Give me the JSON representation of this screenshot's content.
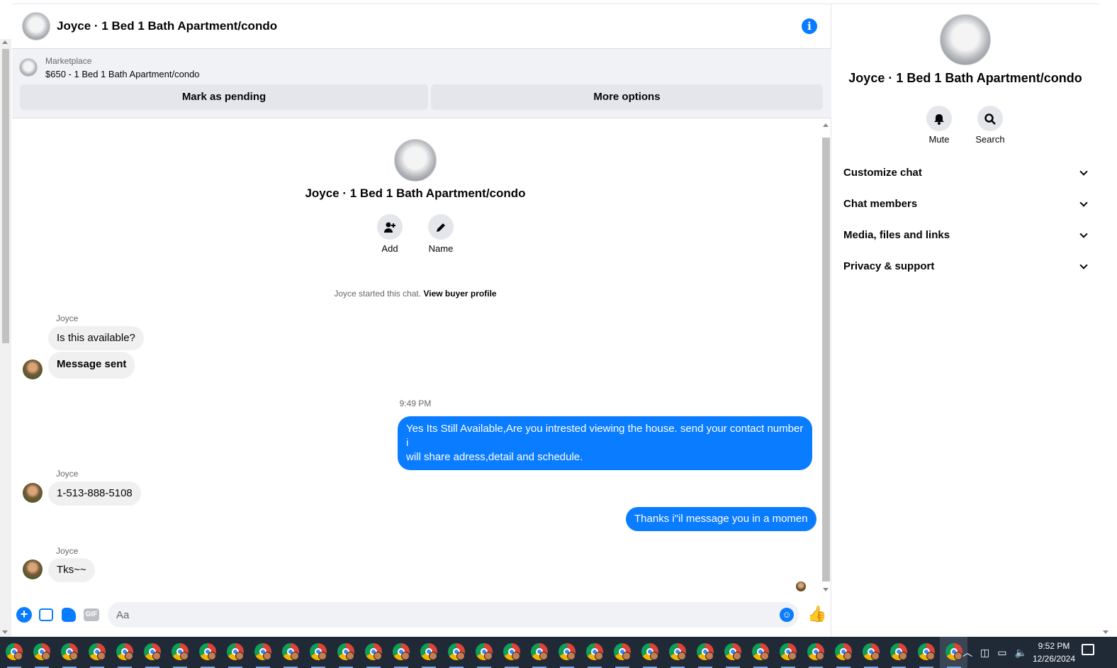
{
  "header": {
    "title": "Joyce · 1 Bed 1 Bath Apartment/condo",
    "info_icon": "info-icon"
  },
  "marketplace": {
    "label": "Marketplace",
    "listing": "$650 - 1 Bed 1 Bath Apartment/condo",
    "pending_button": "Mark as pending",
    "options_button": "More options"
  },
  "intro": {
    "title": "Joyce · 1 Bed 1 Bath Apartment/condo",
    "add_label": "Add",
    "name_label": "Name",
    "started_text": "Joyce started this chat.",
    "buyer_link": "View buyer profile"
  },
  "messages": {
    "sender_1": "Joyce",
    "in_1": "Is this available?",
    "in_2": "Message sent",
    "time_1": "9:49 PM",
    "out_1_line1": "Yes Its Still Available,Are you intrested viewing the house. send your contact number i",
    "out_1_line2": "will share adress,detail and schedule.",
    "sender_2": "Joyce",
    "in_3": "1-513-888-5108",
    "out_2": "Thanks i\"il message you in a momen",
    "sender_3": "Joyce",
    "in_4": "Tks~~"
  },
  "composer": {
    "placeholder": "Aa",
    "gif_label": "GIF"
  },
  "panel": {
    "title": "Joyce · 1 Bed 1 Bath Apartment/condo",
    "mute_label": "Mute",
    "search_label": "Search",
    "sections": [
      "Customize chat",
      "Chat members",
      "Media, files and links",
      "Privacy & support"
    ]
  },
  "taskbar": {
    "time": "9:52 PM",
    "date": "12/26/2024"
  },
  "colors": {
    "accent": "#0a7cff",
    "bubble_in": "#f0f0f0",
    "taskbar": "#1f2a36"
  }
}
